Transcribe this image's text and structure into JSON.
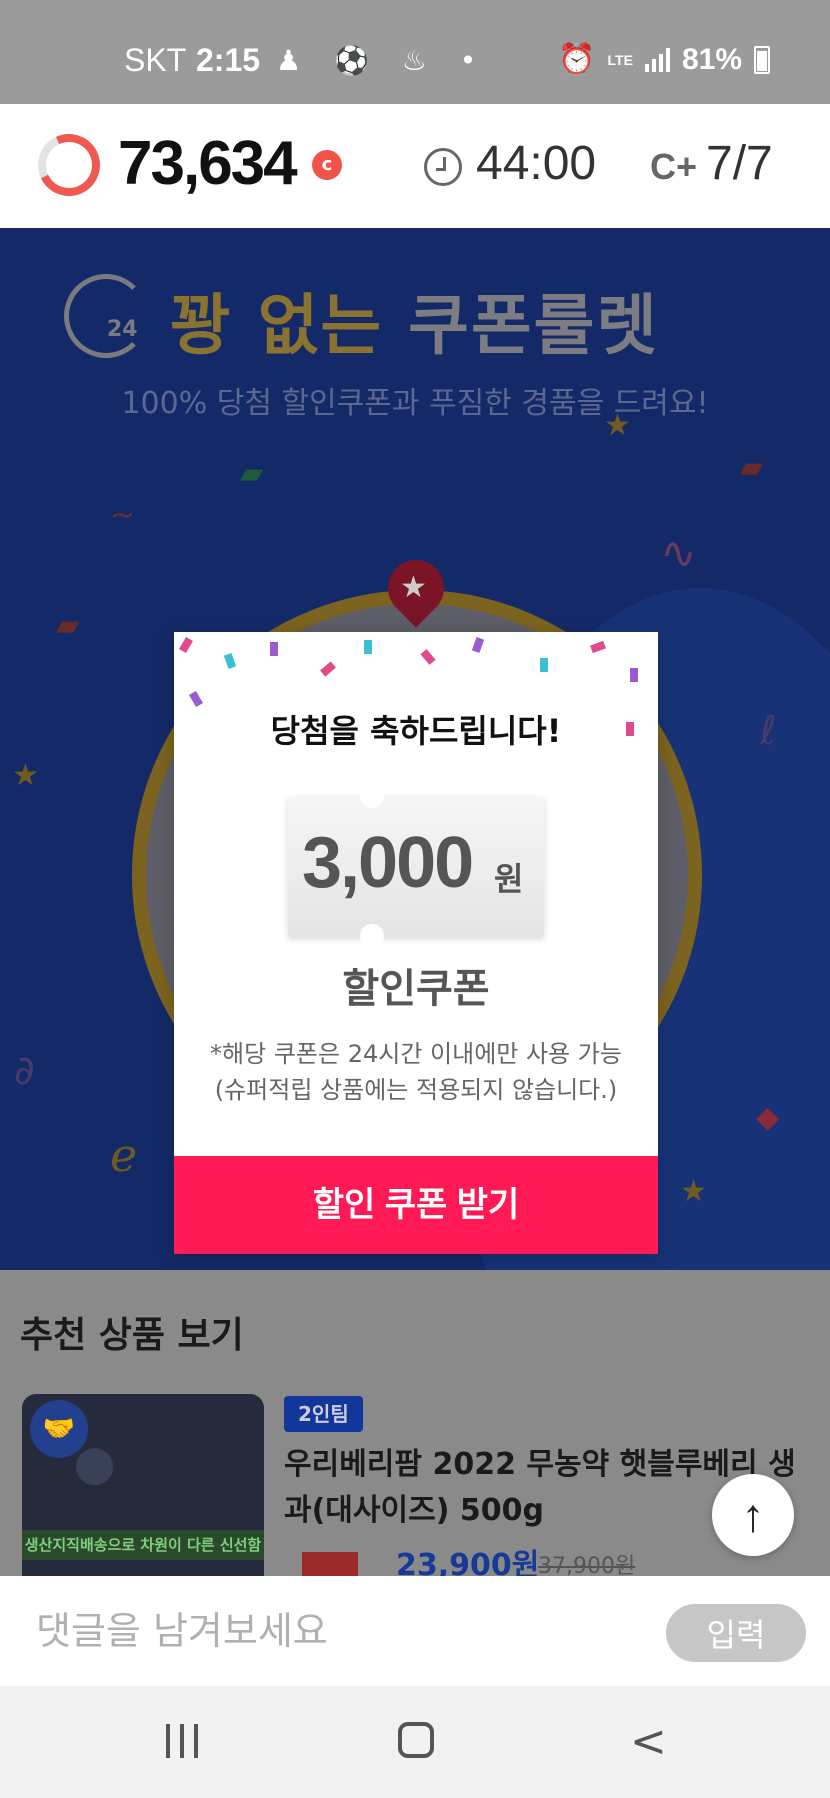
{
  "status_bar": {
    "carrier": "SKT",
    "time": "2:15",
    "network": "LTE",
    "battery": "81%"
  },
  "header": {
    "points": "73,634",
    "points_unit": "c",
    "timer": "44:00",
    "count": "7/7"
  },
  "banner": {
    "clock_label": "24",
    "title_part1": "꽝 없는",
    "title_part2": "쿠폰룰렛",
    "subtitle": "100% 당첨 할인쿠폰과 푸짐한 경품을 드려요!"
  },
  "modal": {
    "headline": "당첨을 축하드립니다!",
    "amount": "3,000",
    "currency": "원",
    "coupon_type": "할인쿠폰",
    "note_line1": "*해당 쿠폰은 24시간 이내에만 사용 가능",
    "note_line2": "(슈퍼적립 상품에는 적용되지 않습니다.)",
    "cta": "할인 쿠폰 받기"
  },
  "recommended": {
    "heading": "추천 상품 보기",
    "product": {
      "badge": "2인팀",
      "name": "우리베리팜 2022 무농약 햇블루베리 생과(대사이즈) 500g",
      "price": "23,900원",
      "original_price": "37,900원",
      "thumb_caption": "생산지직배송으로 차원이 다른 신선함"
    }
  },
  "comment": {
    "placeholder": "댓글을 남겨보세요",
    "submit": "입력"
  },
  "colors": {
    "accent": "#ff1a55",
    "banner_bg": "#142a68",
    "points_ring": "#ef5a50"
  },
  "icons": [
    "clock-icon",
    "coin-plus-icon",
    "arrow-up-icon",
    "recent-apps-icon",
    "home-icon",
    "back-icon"
  ]
}
